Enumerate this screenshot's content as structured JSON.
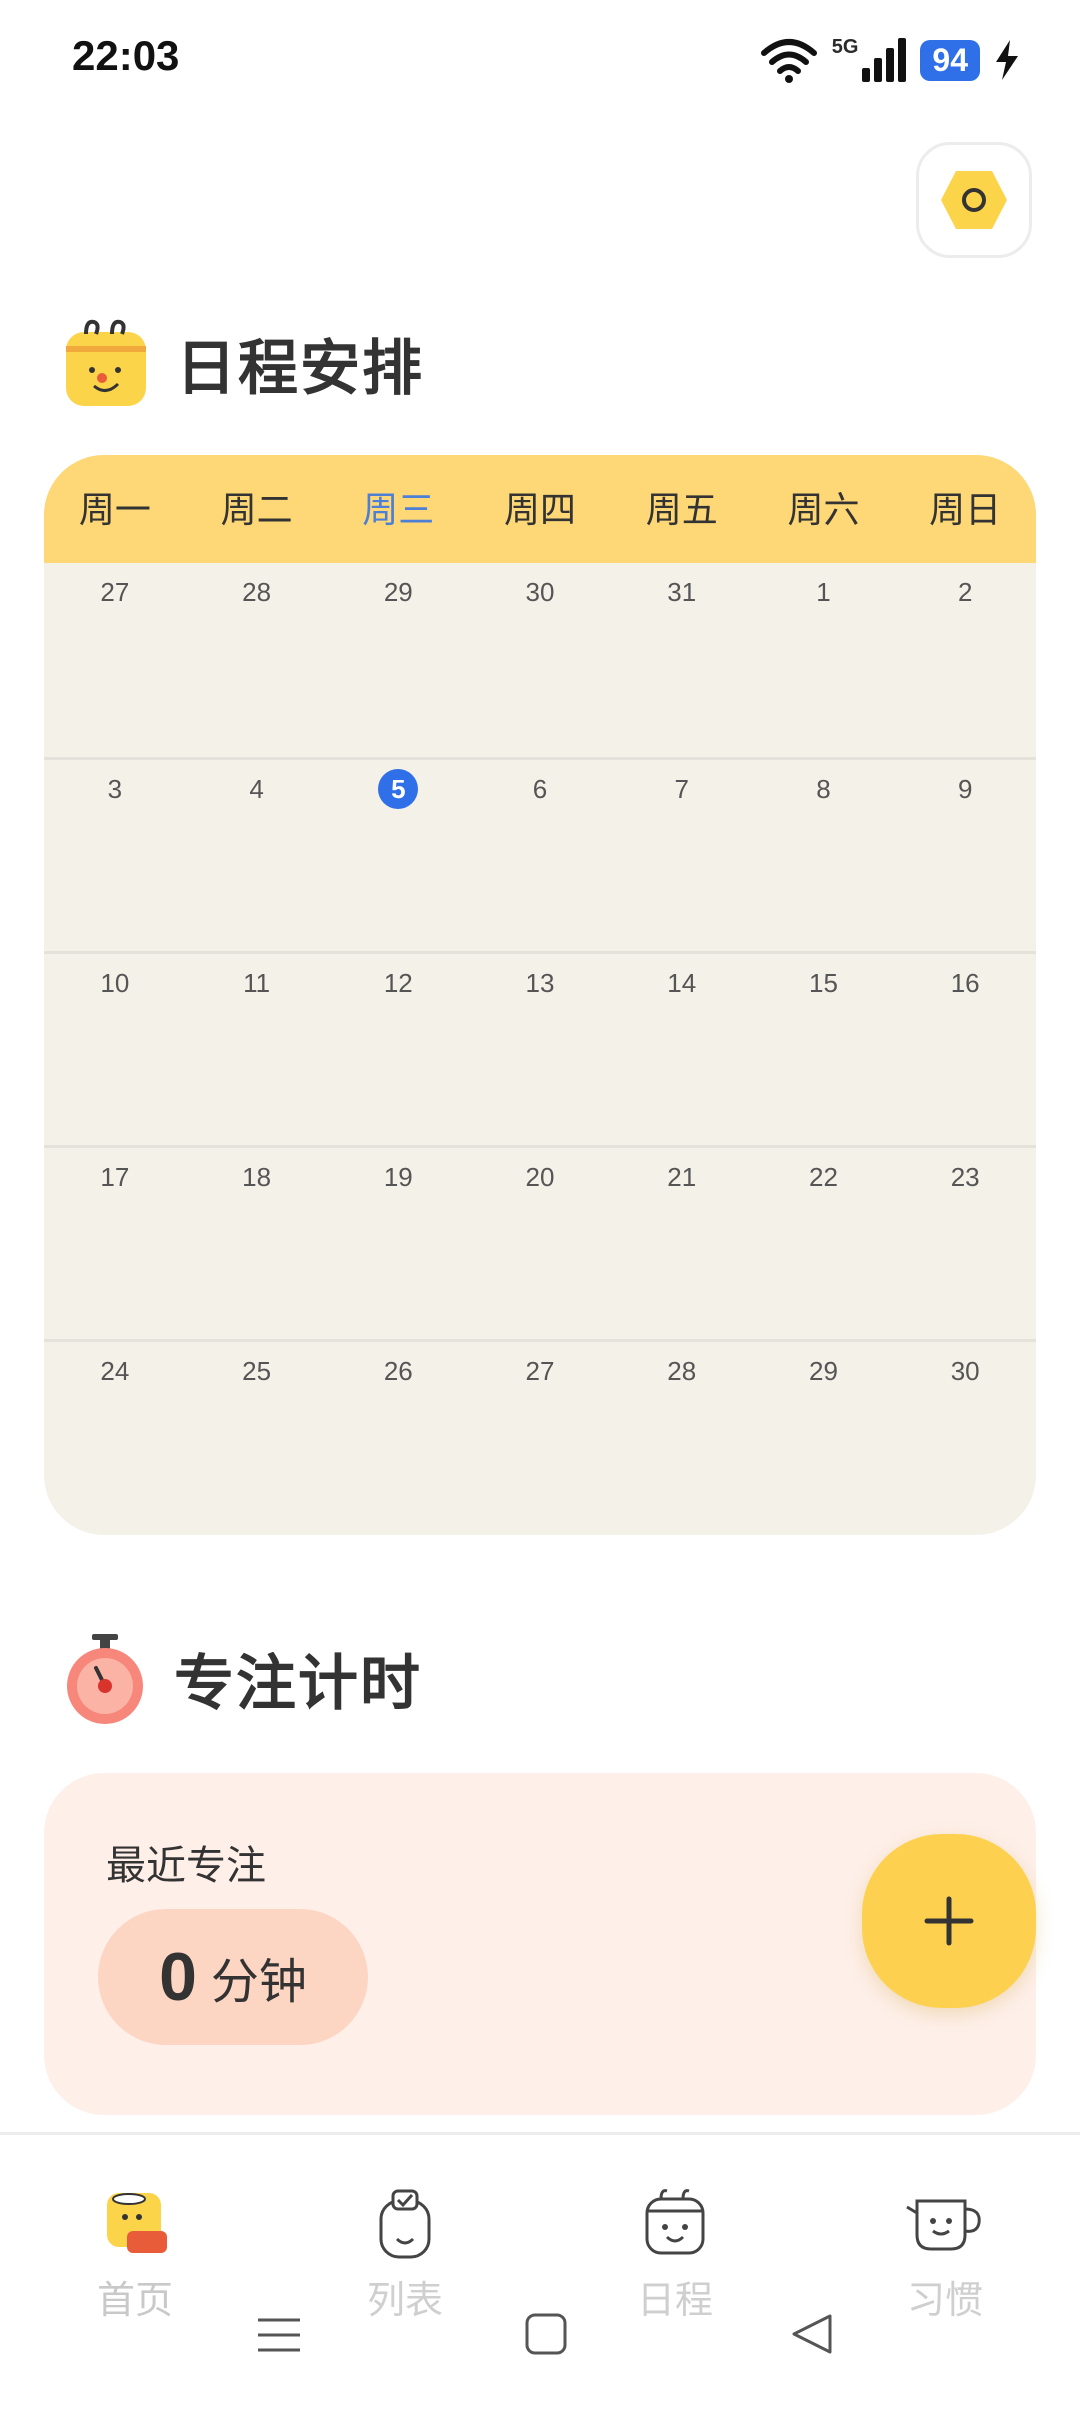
{
  "status_bar": {
    "time": "22:03",
    "network": "5G",
    "battery": "94",
    "icons": [
      "wifi-icon",
      "signal-icon",
      "battery-icon",
      "charging-icon"
    ]
  },
  "settings_icon": "settings-hex-icon",
  "schedule": {
    "title": "日程安排",
    "weekdays": [
      "周一",
      "周二",
      "周三",
      "周四",
      "周五",
      "周六",
      "周日"
    ],
    "active_weekday": "周三",
    "weeks": [
      [
        "27",
        "28",
        "29",
        "30",
        "31",
        "1",
        "2"
      ],
      [
        "3",
        "4",
        "5",
        "6",
        "7",
        "8",
        "9"
      ],
      [
        "10",
        "11",
        "12",
        "13",
        "14",
        "15",
        "16"
      ],
      [
        "17",
        "18",
        "19",
        "20",
        "21",
        "22",
        "23"
      ],
      [
        "24",
        "25",
        "26",
        "27",
        "28",
        "29",
        "30"
      ]
    ],
    "today": "5"
  },
  "focus": {
    "title": "专注计时",
    "recent_label": "最近专注",
    "minutes": "0",
    "unit": "分钟"
  },
  "fab_icon": "plus-icon",
  "bottom_nav": {
    "items": [
      {
        "label": "首页",
        "icon": "home-mascot-icon"
      },
      {
        "label": "列表",
        "icon": "list-mascot-icon"
      },
      {
        "label": "日程",
        "icon": "calendar-mascot-icon"
      },
      {
        "label": "习惯",
        "icon": "habit-mascot-icon"
      }
    ]
  },
  "colors": {
    "accent_yellow": "#fed876",
    "today_blue": "#2f6fe8",
    "focus_bg": "#feefe9"
  }
}
